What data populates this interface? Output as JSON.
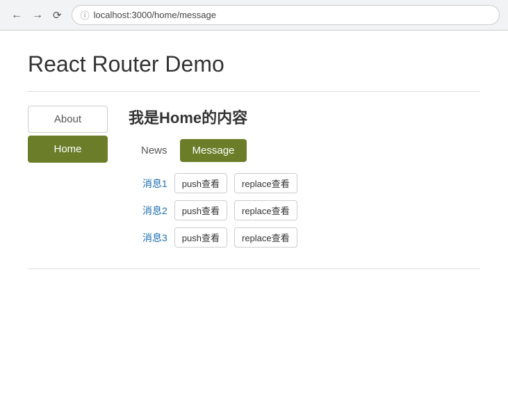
{
  "browser": {
    "url": "localhost:3000/home/message"
  },
  "page": {
    "title": "React Router Demo"
  },
  "left_nav": {
    "items": [
      {
        "label": "About",
        "active": false
      },
      {
        "label": "Home",
        "active": true
      }
    ]
  },
  "home_section": {
    "title": "我是Home的内容",
    "sub_nav": [
      {
        "label": "News",
        "active": false
      },
      {
        "label": "Message",
        "active": true
      }
    ],
    "messages": [
      {
        "link_label": "消息1",
        "push_label": "push查看",
        "replace_label": "replace查看"
      },
      {
        "link_label": "消息2",
        "push_label": "push查看",
        "replace_label": "replace查看"
      },
      {
        "link_label": "消息3",
        "push_label": "push查看",
        "replace_label": "replace查看"
      }
    ]
  }
}
